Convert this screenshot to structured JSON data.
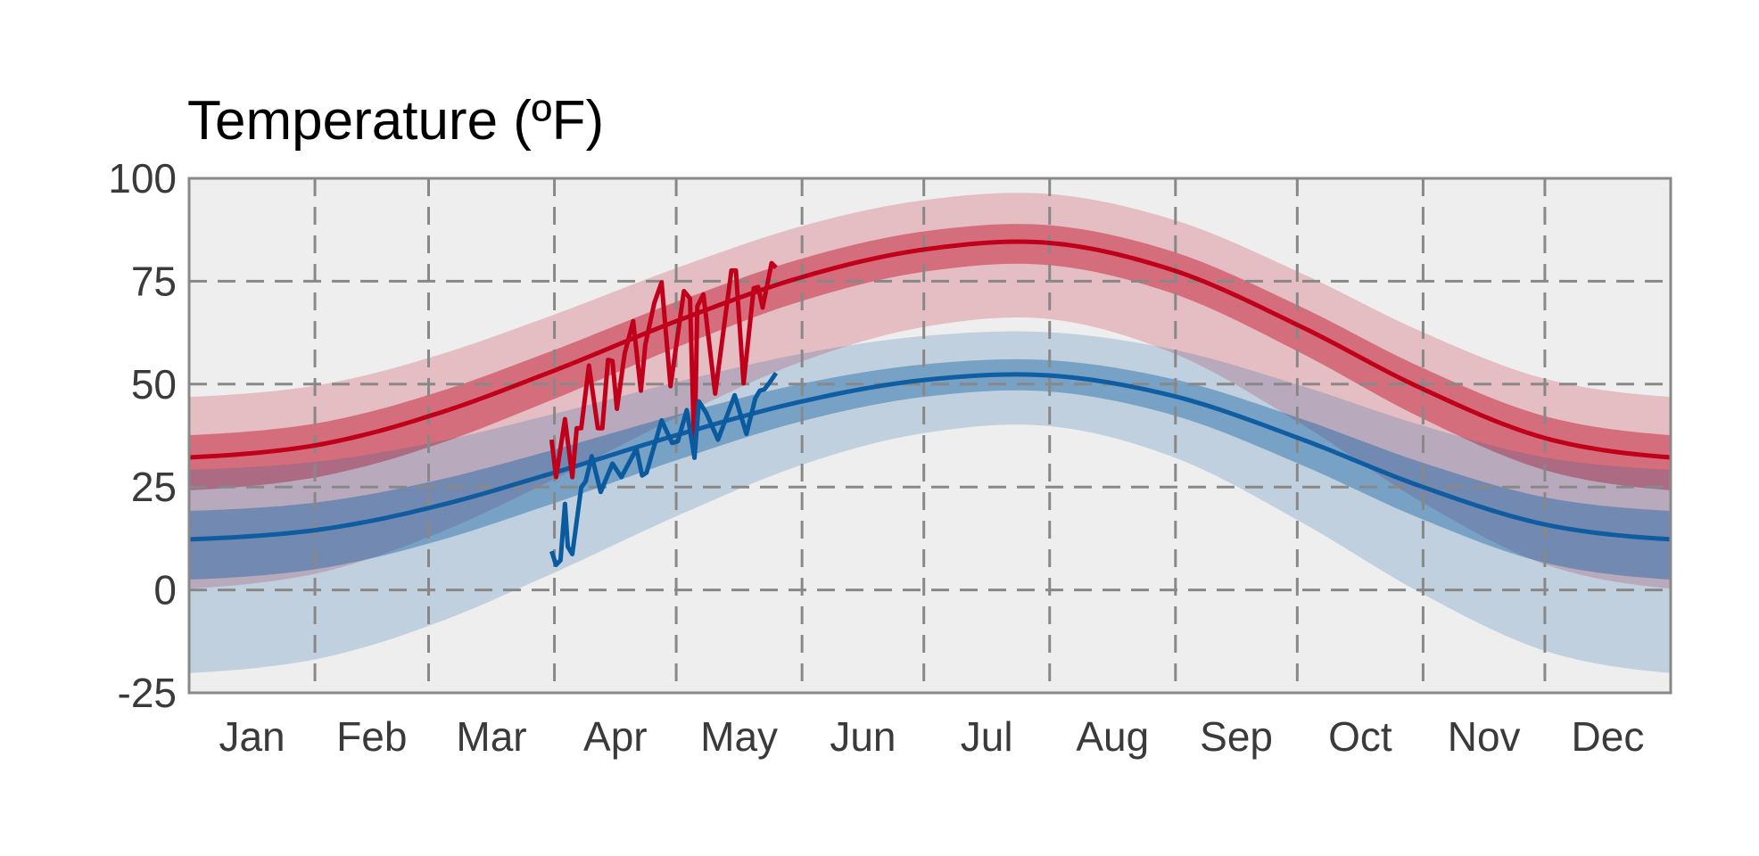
{
  "chart_data": {
    "type": "line",
    "title": "Temperature (ºF)",
    "xlabel": "",
    "ylabel": "",
    "ylim": [
      -25,
      100
    ],
    "xlim_days": [
      0,
      365
    ],
    "yticks": [
      "-25",
      "0",
      "25",
      "50",
      "75",
      "100"
    ],
    "ytick_values": [
      -25,
      0,
      25,
      50,
      75,
      100
    ],
    "month_labels": [
      "Jan",
      "Feb",
      "Mar",
      "Apr",
      "May",
      "Jun",
      "Jul",
      "Aug",
      "Sep",
      "Oct",
      "Nov",
      "Dec"
    ],
    "month_start_days": [
      0,
      31,
      59,
      90,
      120,
      151,
      181,
      212,
      243,
      273,
      304,
      334,
      365
    ],
    "grid": true,
    "normals": {
      "sample_days": [
        0,
        31,
        59,
        90,
        120,
        151,
        181,
        212,
        243,
        273,
        304,
        334,
        365
      ],
      "high": {
        "outer_upper": [
          46.9,
          49.6,
          56.4,
          66.9,
          78.2,
          88.4,
          94.7,
          96.2,
          89.8,
          77.4,
          62.6,
          51.3,
          46.9
        ],
        "inner_upper": [
          37.6,
          40.4,
          47.4,
          58.3,
          70.0,
          80.5,
          87.1,
          88.6,
          82.0,
          69.2,
          53.9,
          42.2,
          37.6
        ],
        "mean": [
          32.2,
          35.1,
          42.2,
          53.3,
          65.3,
          76.0,
          82.7,
          84.3,
          77.5,
          64.4,
          48.8,
          36.9,
          32.2
        ],
        "inner_lower": [
          24.2,
          27.3,
          34.7,
          46.4,
          58.9,
          70.2,
          77.3,
          78.9,
          71.8,
          58.0,
          41.6,
          29.1,
          24.2
        ],
        "outer_lower": [
          0.3,
          3.9,
          12.9,
          26.9,
          41.9,
          55.5,
          63.9,
          65.8,
          57.3,
          40.9,
          21.2,
          6.2,
          0.3
        ]
      },
      "low": {
        "outer_upper": [
          29.2,
          31.1,
          35.6,
          42.8,
          50.5,
          57.4,
          61.7,
          62.6,
          58.3,
          49.9,
          39.9,
          32.2,
          29.2
        ],
        "inner_upper": [
          19.2,
          21.2,
          26.2,
          34.1,
          42.5,
          50.1,
          54.8,
          55.8,
          51.1,
          41.9,
          30.9,
          22.5,
          19.2
        ],
        "mean": [
          12.3,
          14.5,
          19.9,
          28.5,
          37.6,
          45.8,
          51.0,
          52.1,
          47.0,
          37.0,
          25.0,
          15.9,
          12.3
        ],
        "inner_lower": [
          2.5,
          5.0,
          11.3,
          21.1,
          31.5,
          41.0,
          46.9,
          48.2,
          42.3,
          30.8,
          17.1,
          6.6,
          2.5
        ],
        "outer_lower": [
          -20.2,
          -16.9,
          -8.7,
          4.2,
          17.9,
          30.4,
          38.1,
          39.8,
          32.1,
          17.0,
          -1.0,
          -14.8,
          -20.2
        ]
      }
    },
    "series": [
      {
        "name": "observed high",
        "days": [
          89.3,
          90.4,
          92.6,
          94.4,
          95.5,
          96.6,
          98.5,
          100.7,
          101.8,
          103.2,
          104.3,
          105.4,
          107.3,
          109.4,
          111.3,
          112.4,
          114.6,
          116.4,
          118.6,
          121.9,
          123.4,
          124.5,
          125.2,
          126.7,
          129.6,
          133.6,
          134.7,
          136.6,
          139.1,
          140.2,
          141.3,
          143.5,
          144.6
        ],
        "values": [
          36.5,
          27.4,
          41.5,
          27.4,
          39.3,
          39.3,
          54.5,
          39.3,
          39.3,
          55.9,
          55.6,
          44.0,
          57.4,
          65.3,
          48.4,
          59.6,
          69.7,
          74.7,
          49.5,
          72.6,
          70.8,
          32.5,
          68.9,
          71.8,
          47.7,
          77.6,
          77.6,
          50.2,
          73.3,
          73.6,
          68.6,
          79.4,
          78.3
        ]
      },
      {
        "name": "observed low",
        "days": [
          89.3,
          90.4,
          91.5,
          92.6,
          93.3,
          94.4,
          96.6,
          97.7,
          99.2,
          101.4,
          104.3,
          106.5,
          110.2,
          111.6,
          112.7,
          116.4,
          119.0,
          120.4,
          122.6,
          124.5,
          125.6,
          127.4,
          130.3,
          134.4,
          137.3,
          139.5,
          140.6,
          141.7,
          143.1,
          144.6
        ],
        "values": [
          9.4,
          6.1,
          7.2,
          20.9,
          10.5,
          8.7,
          24.9,
          26.4,
          32.5,
          23.8,
          30.7,
          27.4,
          34.3,
          27.8,
          28.5,
          41.2,
          35.7,
          36.1,
          43.7,
          32.1,
          45.8,
          43.0,
          36.5,
          47.3,
          37.9,
          46.6,
          48.4,
          48.7,
          50.5,
          52.7
        ]
      }
    ],
    "colors": {
      "high_line": "#c0001a",
      "high_band": "#c0001a",
      "low_line": "#0a5aa0",
      "low_band": "#0a5aa0",
      "plot_bg": "#eeeeee",
      "grid": "#888888"
    }
  }
}
